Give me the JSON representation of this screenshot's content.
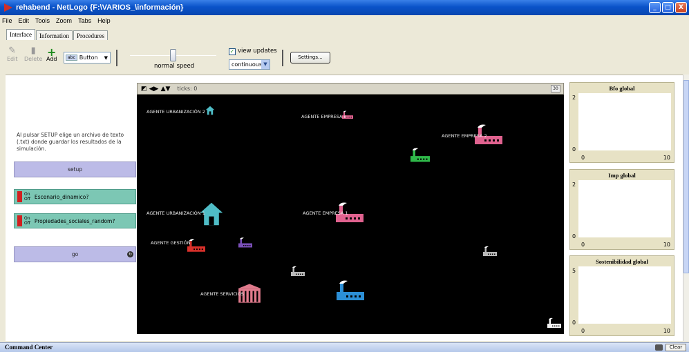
{
  "window": {
    "title": "rehabend - NetLogo {F:\\VARIOS_\\información}",
    "min": "_",
    "max": "□",
    "close": "X"
  },
  "menu": [
    "File",
    "Edit",
    "Tools",
    "Zoom",
    "Tabs",
    "Help"
  ],
  "tabs": [
    "Interface",
    "Information",
    "Procedures"
  ],
  "toolbar": {
    "edit": "Edit",
    "delete": "Delete",
    "add": "Add",
    "widget_type": "Button",
    "widget_type_icon": "abc",
    "speed_label": "normal speed",
    "speed_value": 0.5,
    "view_updates_label": "view updates",
    "view_updates_checked": true,
    "update_mode": "continuous",
    "settings_label": "Settings..."
  },
  "left_panel": {
    "note": "Al pulsar SETUP elige un archivo de texto (.txt) donde guardar los resultados de la simulación.",
    "setup_label": "setup",
    "switch_on": "On",
    "switch_off": "Off",
    "switch1_label": "Escenario_dinamico?",
    "switch2_label": "Propiedades_sociales_random?",
    "go_label": "go"
  },
  "view": {
    "ticks": "ticks: 0",
    "speed_badge": "30"
  },
  "agents": [
    {
      "label": "AGENTE URBANIZACIÓN 2"
    },
    {
      "label": "AGENTE EMPRESA n"
    },
    {
      "label": "AGENTE EMPRESA 2"
    },
    {
      "label": "AGENTE URBANIZACIÓN 1"
    },
    {
      "label": "AGENTE EMPRESA 1"
    },
    {
      "label": "AGENTE GESTIÓN"
    },
    {
      "label": "AGENTE SERVICIOS"
    }
  ],
  "colors": {
    "teal": "#4fbcc6",
    "pink": "#e0628f",
    "green": "#2fb84a",
    "purple": "#7a4fb8",
    "grey": "#b8b8b8",
    "blue": "#2c8fd6",
    "red": "#d8302a",
    "white": "#f2f2f2",
    "rose": "#e07a8c"
  },
  "plots": [
    {
      "title": "Bfo global",
      "ymax": "2",
      "ymin": "0",
      "xmin": "0",
      "xmax": "10"
    },
    {
      "title": "Imp global",
      "ymax": "2",
      "ymin": "0",
      "xmin": "0",
      "xmax": "10"
    },
    {
      "title": "Sostenibilidad global",
      "ymax": "5",
      "ymin": "0",
      "xmin": "0",
      "xmax": "10"
    }
  ],
  "command_center": {
    "title": "Command Center",
    "clear": "Clear"
  }
}
